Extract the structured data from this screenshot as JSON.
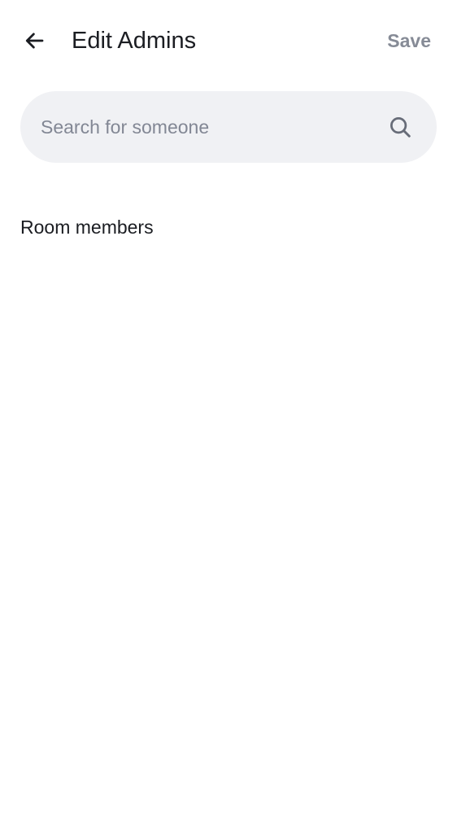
{
  "header": {
    "back_icon": "arrow-left-icon",
    "title": "Edit Admins",
    "save_label": "Save"
  },
  "search": {
    "placeholder": "Search for someone",
    "value": "",
    "icon": "search-icon"
  },
  "members": {
    "section_title": "Room members",
    "items": []
  },
  "colors": {
    "text_primary": "#1b1d22",
    "text_secondary": "#868b96",
    "search_background": "#f0f1f4"
  }
}
